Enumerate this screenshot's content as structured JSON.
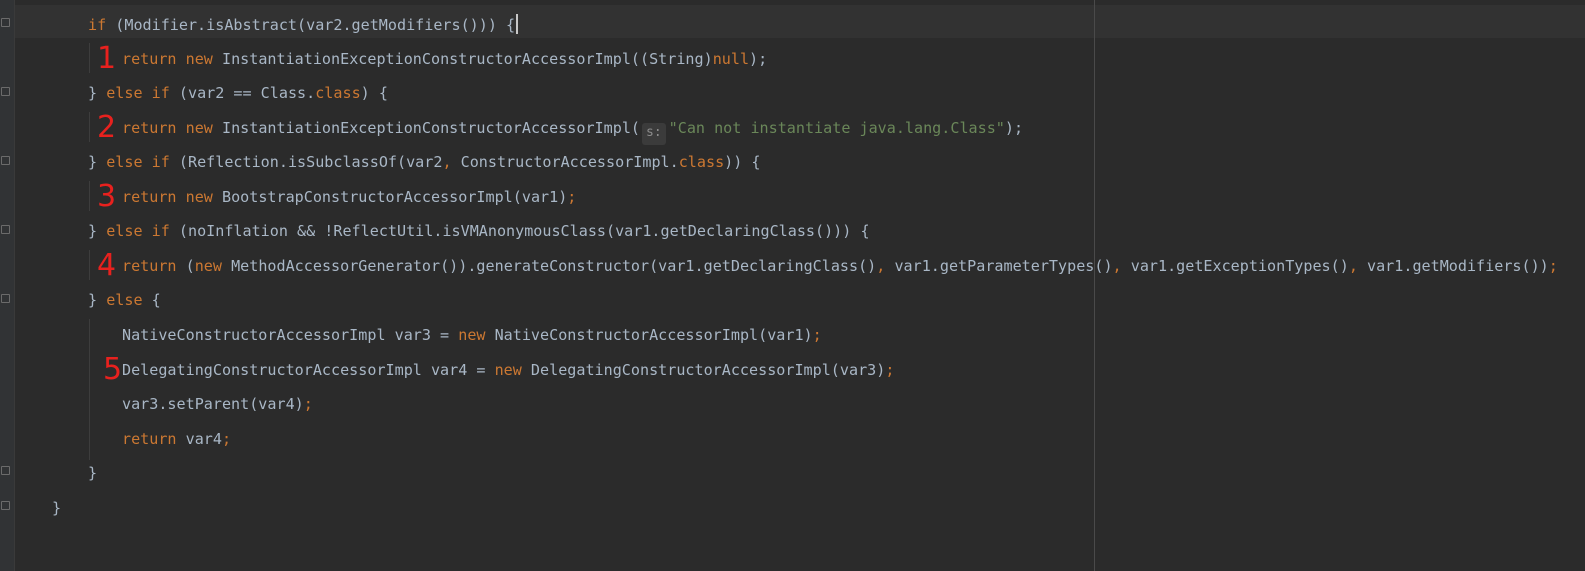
{
  "code": {
    "l1": {
      "t1": "if",
      "t2": " (Modifier.isAbstract(var2.getModifiers())) {"
    },
    "l2": {
      "t1": "return",
      "t2": " ",
      "t3": "new",
      "t4": " InstantiationExceptionConstructorAccessorImpl((String)",
      "t5": "null",
      "t6": ");"
    },
    "l3": {
      "t1": "} ",
      "t2": "else if",
      "t3": " (var2 == Class.",
      "t4": "class",
      "t5": ") {"
    },
    "l4": {
      "t1": "return",
      "t2": " ",
      "t3": "new",
      "t4": " InstantiationExceptionConstructorAccessorImpl(",
      "hint": "s:",
      "str": "\"Can not instantiate java.lang.Class\"",
      "t5": ");"
    },
    "l5": {
      "t1": "} ",
      "t2": "else if",
      "t3": " (Reflection.isSubclassOf(var2",
      "t4": ",",
      "t5": " ConstructorAccessorImpl.",
      "t6": "class",
      "t7": ")) {"
    },
    "l6": {
      "t1": "return",
      "t2": " ",
      "t3": "new",
      "t4": " BootstrapConstructorAccessorImpl(var1)",
      "t5": ";"
    },
    "l7": {
      "t1": "} ",
      "t2": "else if",
      "t3": " (noInflation && !ReflectUtil.isVMAnonymousClass(var1.getDeclaringClass())) {"
    },
    "l8": {
      "t1": "return",
      "t2": " (",
      "t3": "new",
      "t4": " MethodAccessorGenerator()).generateConstructor(var1.getDeclaringClass()",
      "t5": ",",
      "t6": " var1.getParameterTypes()",
      "t7": ",",
      "t8": " var1.getExceptionTypes()",
      "t9": ",",
      "t10": " var1.getModifiers())",
      "t11": ";"
    },
    "l9": {
      "t1": "} ",
      "t2": "else",
      "t3": " {"
    },
    "l10": {
      "t1": "NativeConstructorAccessorImpl var3 = ",
      "t2": "new",
      "t3": " NativeConstructorAccessorImpl(var1)",
      "t4": ";"
    },
    "l11": {
      "t1": "DelegatingConstructorAccessorImpl var4 = ",
      "t2": "new",
      "t3": " DelegatingConstructorAccessorImpl(var3)",
      "t4": ";"
    },
    "l12": {
      "t1": "var3.setParent(var4)",
      "t2": ";"
    },
    "l13": {
      "t1": "return",
      "t2": " var4",
      "t3": ";"
    },
    "l14": {
      "t1": "}"
    },
    "l15": {
      "t1": "}"
    }
  },
  "annotations": [
    "1",
    "2",
    "3",
    "4",
    "5"
  ],
  "colors": {
    "background": "#2b2b2b",
    "keyword": "#cc7832",
    "string": "#6a8759",
    "identifier": "#a9b7c6",
    "annotation": "#e8211e"
  }
}
